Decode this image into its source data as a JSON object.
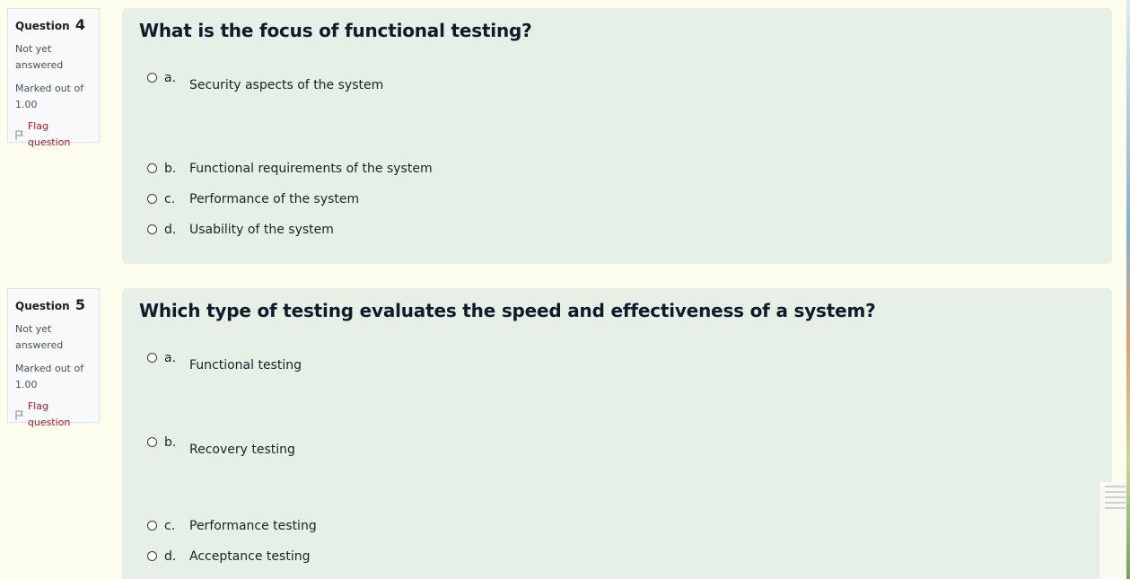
{
  "questions": [
    {
      "label": "Question",
      "number": "4",
      "state": "Not yet answered",
      "grade": "Marked out of 1.00",
      "flag": "Flag question",
      "text": "What is the focus of functional testing?",
      "options": [
        {
          "letter": "a.",
          "text": "Security aspects of the system"
        },
        {
          "letter": "b.",
          "text": "Functional requirements of the system"
        },
        {
          "letter": "c.",
          "text": "Performance of the system"
        },
        {
          "letter": "d.",
          "text": "Usability of the system"
        }
      ]
    },
    {
      "label": "Question",
      "number": "5",
      "state": "Not yet answered",
      "grade": "Marked out of 1.00",
      "flag": "Flag question",
      "text": "Which type of testing evaluates the speed and effectiveness of a system?",
      "options": [
        {
          "letter": "a.",
          "text": "Functional testing"
        },
        {
          "letter": "b.",
          "text": "Recovery testing"
        },
        {
          "letter": "c.",
          "text": "Performance testing"
        },
        {
          "letter": "d.",
          "text": "Acceptance testing"
        }
      ]
    }
  ],
  "colors": {
    "page_bg": "#fdfdee",
    "content_bg": "#e6f0e6",
    "flag": "#a1212b"
  },
  "icons": {
    "flag": "flag-icon",
    "radio": "radio-icon"
  }
}
